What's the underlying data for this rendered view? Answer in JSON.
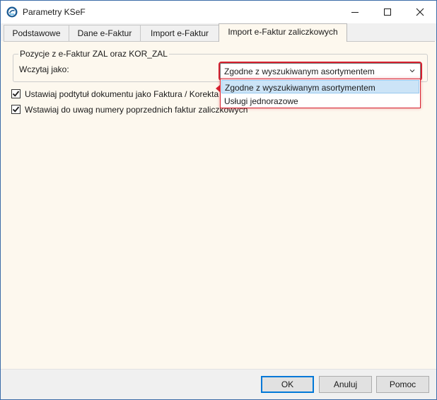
{
  "window": {
    "title": "Parametry KSeF"
  },
  "tabs": [
    {
      "label": "Podstawowe"
    },
    {
      "label": "Dane e-Faktur"
    },
    {
      "label": "Import e-Faktur"
    },
    {
      "label": "Import e-Faktur zaliczkowych"
    }
  ],
  "active_tab": "Import e-Faktur zaliczkowych",
  "group": {
    "legend": "Pozycje z e-Faktur ZAL oraz KOR_ZAL",
    "field_label": "Wczytaj jako:",
    "combo_value": "Zgodne z wyszukiwanym asortymentem",
    "options": [
      {
        "label": "Zgodne z wyszukiwanym asortymentem",
        "selected": true
      },
      {
        "label": "Usługi jednorazowe",
        "selected": false
      }
    ]
  },
  "checkboxes": [
    {
      "label": "Ustawiaj podtytuł dokumentu jako Faktura / Korekta zaliczkowa",
      "checked": true
    },
    {
      "label": "Wstawiaj do uwag numery poprzednich faktur zaliczkowych",
      "checked": true
    }
  ],
  "buttons": {
    "ok": "OK",
    "cancel": "Anuluj",
    "help": "Pomoc"
  },
  "colors": {
    "highlight_border": "#d6202f",
    "selection_bg": "#cce4f7",
    "default_button_border": "#0078d7",
    "content_bg": "#fdf8ee"
  },
  "icons": {
    "app": "ksef-app-icon",
    "minimize": "minimize-icon",
    "maximize": "maximize-icon",
    "close": "close-icon",
    "dropdown": "chevron-down-icon",
    "check": "checkmark-icon"
  }
}
